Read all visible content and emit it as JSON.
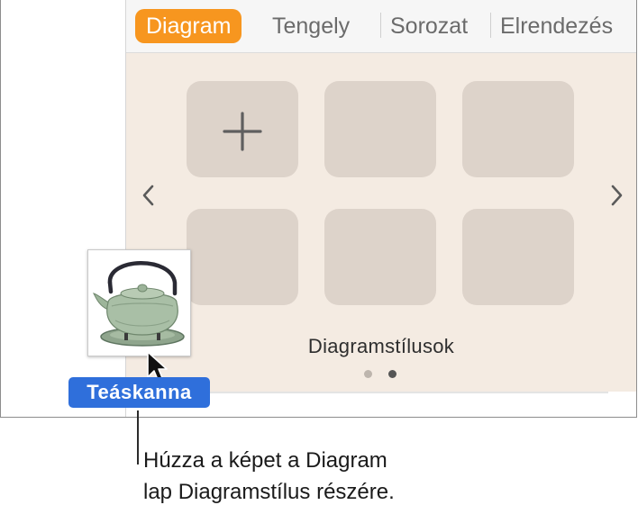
{
  "inspector": {
    "tabs": [
      {
        "label": "Diagram",
        "active": true
      },
      {
        "label": "Tengely",
        "active": false
      },
      {
        "label": "Sorozat",
        "active": false
      },
      {
        "label": "Elrendezés",
        "active": false
      }
    ],
    "styles_label": "Diagramstílusok",
    "page_count": 2,
    "current_page": 2
  },
  "drag": {
    "label": "Teáskanna"
  },
  "callout": {
    "line1": "Húzza a képet a Diagram",
    "line2": "lap Diagramstílus részére."
  },
  "colors": {
    "accent": "#f7961f",
    "panel_bg": "#f4ebe2",
    "tile": "#ddd3ca",
    "drag_label": "#2f6fdb"
  }
}
